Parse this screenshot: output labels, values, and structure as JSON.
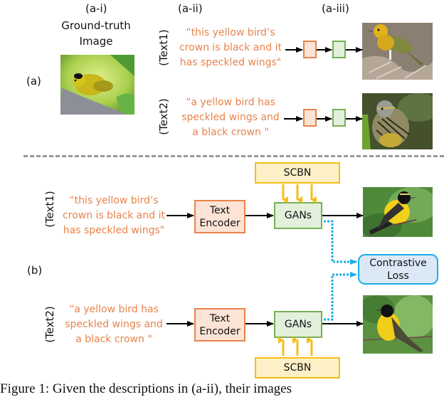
{
  "part_a": {
    "label": "(a)",
    "column_labels": [
      "(a-i)",
      "(a-ii)",
      "(a-iii)"
    ],
    "ground_truth_title": "Ground-truth\nImage",
    "ground_truth_title_line1": "Ground-truth",
    "ground_truth_title_line2": "Image",
    "rows": [
      {
        "tag": "(Text1)",
        "quote_lines": [
          "“this yellow bird’s",
          "crown is black and it",
          "has speckled wings\""
        ],
        "output_image": "yellow-headed bird on dry branches"
      },
      {
        "tag": "(Text2)",
        "quote_lines": [
          "“a yellow bird has",
          "speckled wings and",
          "a black crown \""
        ],
        "output_image": "streaked warbler in foliage"
      }
    ],
    "ground_truth_image": "yellow warbler with black cap on branch"
  },
  "part_b": {
    "label": "(b)",
    "rows": [
      {
        "tag": "(Text1)",
        "quote_lines": [
          "“this yellow bird’s",
          "crown is black and it",
          "has speckled wings\""
        ],
        "encoder_lines": [
          "Text",
          "Encoder"
        ],
        "gan_label": "GANs",
        "scbn_label": "SCBN",
        "output_image": "yellow bird with black crown (generated)"
      },
      {
        "tag": "(Text2)",
        "quote_lines": [
          "“a yellow bird has",
          "speckled wings and",
          "a black crown \""
        ],
        "encoder_lines": [
          "Text",
          "Encoder"
        ],
        "gan_label": "GANs",
        "scbn_label": "SCBN",
        "output_image": "yellow bird with black crown (generated)"
      }
    ],
    "contrastive_lines": [
      "Contrastive",
      "Loss"
    ]
  },
  "caption": "Figure 1:   Given the descriptions in (a-ii), their images",
  "colors": {
    "text_orange": "#e8834b",
    "encoder_fill": "#fce3d5",
    "encoder_border": "#e8834b",
    "gan_fill": "#e2f0dc",
    "gan_border": "#77b051",
    "scbn_fill": "#fdf0c7",
    "scbn_border": "#f7bd17",
    "loss_fill": "#dbe9f6",
    "loss_border": "#18aee7",
    "divider": "#999999"
  }
}
